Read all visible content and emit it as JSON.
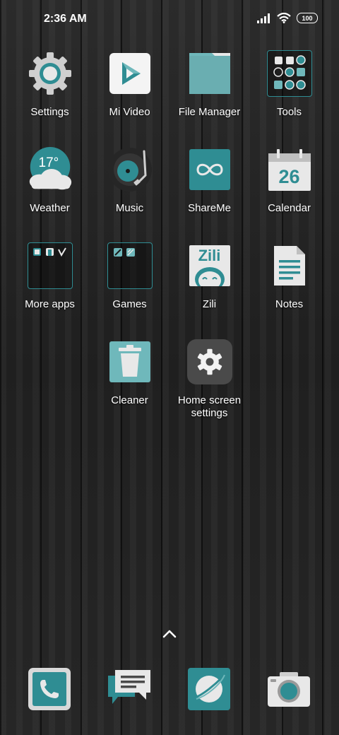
{
  "status_bar": {
    "time": "2:36 AM",
    "battery": "100",
    "icons": [
      "signal-icon",
      "wifi-icon",
      "battery-icon"
    ]
  },
  "apps": [
    {
      "label": "Settings",
      "icon": "gear-icon"
    },
    {
      "label": "Mi Video",
      "icon": "play-icon"
    },
    {
      "label": "File Manager",
      "icon": "folder-icon"
    },
    {
      "label": "Tools",
      "icon": "tools-folder-icon"
    },
    {
      "label": "Weather",
      "icon": "weather-icon",
      "temperature": "17°"
    },
    {
      "label": "Music",
      "icon": "record-player-icon"
    },
    {
      "label": "ShareMe",
      "icon": "infinity-icon"
    },
    {
      "label": "Calendar",
      "icon": "calendar-icon",
      "date": "26"
    },
    {
      "label": "More apps",
      "icon": "more-apps-folder-icon"
    },
    {
      "label": "Games",
      "icon": "games-folder-icon"
    },
    {
      "label": "Zili",
      "icon": "zili-icon",
      "logo_text": "Zili"
    },
    {
      "label": "Notes",
      "icon": "notes-icon"
    },
    {
      "label": "Cleaner",
      "icon": "trash-icon"
    },
    {
      "label": "Home screen settings",
      "icon": "home-settings-icon"
    }
  ],
  "dock": [
    {
      "name": "phone",
      "icon": "phone-icon"
    },
    {
      "name": "messages",
      "icon": "message-icon"
    },
    {
      "name": "browser",
      "icon": "browser-icon"
    },
    {
      "name": "camera",
      "icon": "camera-icon"
    }
  ],
  "colors": {
    "accent": "#2f8d93",
    "accent_light": "#6fb8bb",
    "icon_bg_light": "#e8e8e8"
  }
}
